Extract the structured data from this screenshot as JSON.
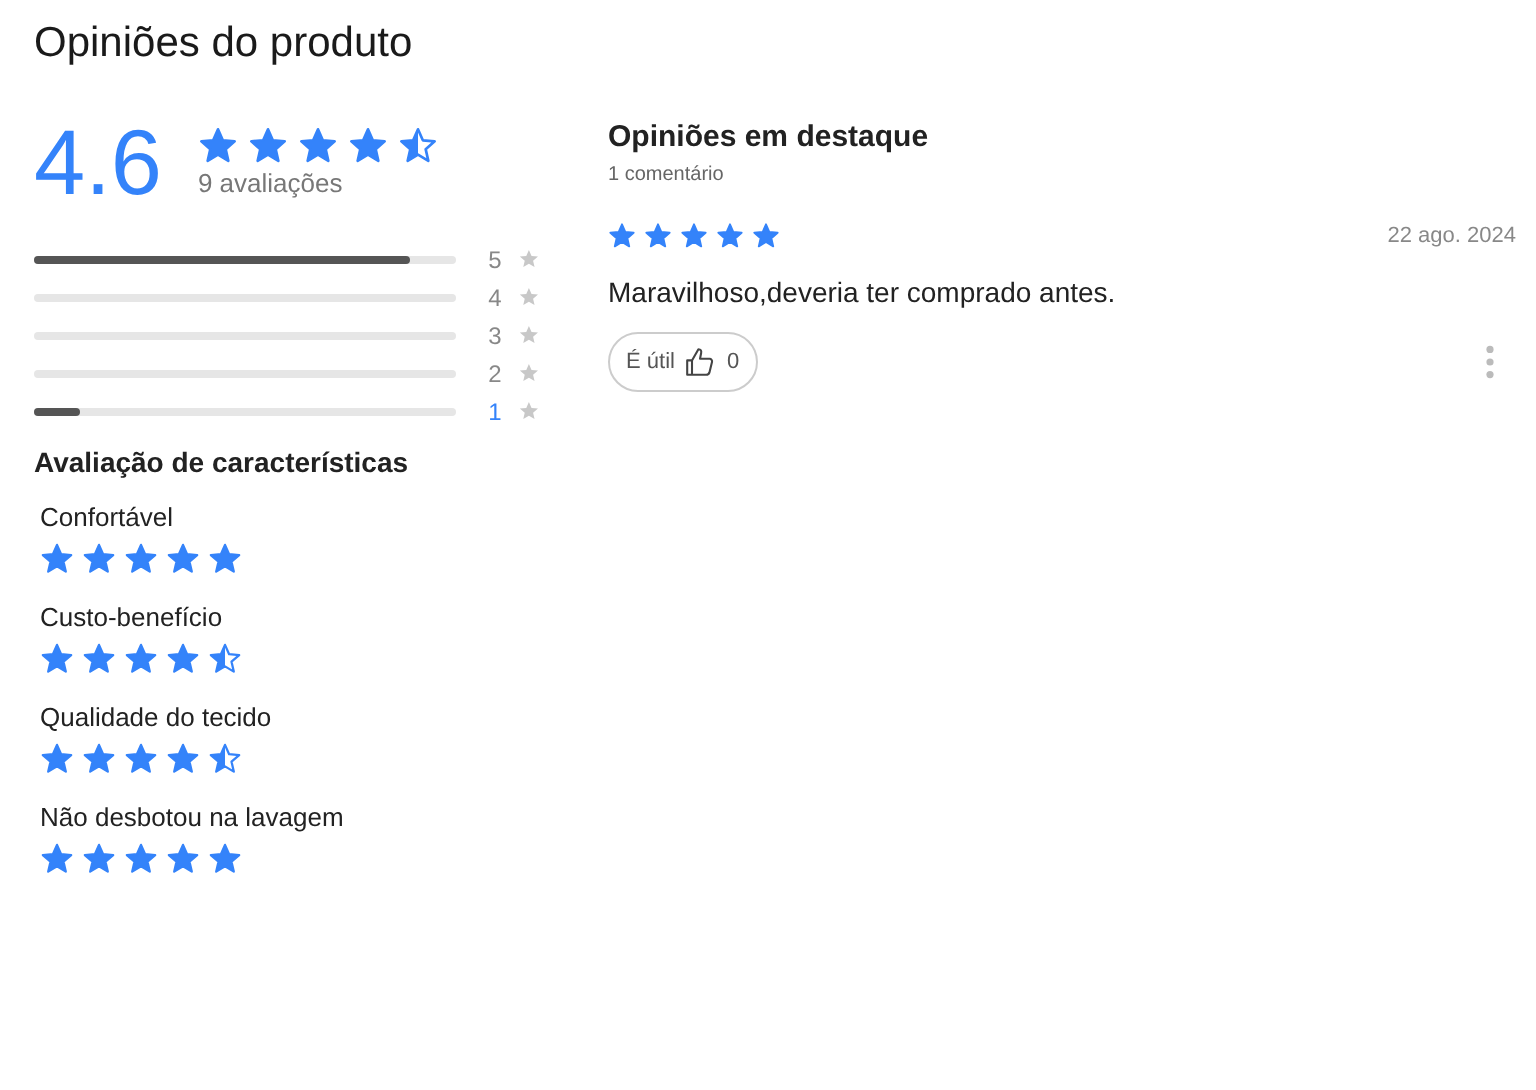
{
  "title": "Opiniões do produto",
  "summary": {
    "average": "4.6",
    "stars": 4.5,
    "count": "9 avaliações"
  },
  "distribution": [
    {
      "label": "5",
      "level": 0.89,
      "active": false
    },
    {
      "label": "4",
      "level": 0,
      "active": false
    },
    {
      "label": "3",
      "level": 0,
      "active": false
    },
    {
      "label": "2",
      "level": 0,
      "active": false
    },
    {
      "label": "1",
      "level": 0.11,
      "active": true
    }
  ],
  "characteristics": {
    "title": "Avaliação de características",
    "items": [
      {
        "label": "Confortável",
        "stars": 5
      },
      {
        "label": "Custo-benefício",
        "stars": 4.5
      },
      {
        "label": "Qualidade do tecido",
        "stars": 4.5
      },
      {
        "label": "Não desbotou na lavagem",
        "stars": 5
      }
    ]
  },
  "featured": {
    "title": "Opiniões em destaque",
    "subtitle": "1 comentário",
    "reviews": [
      {
        "stars": 5,
        "date": "22 ago. 2024",
        "text": "Maravilhoso,deveria ter comprado antes.",
        "helpful_label": "É útil",
        "helpful_count": "0"
      }
    ]
  }
}
